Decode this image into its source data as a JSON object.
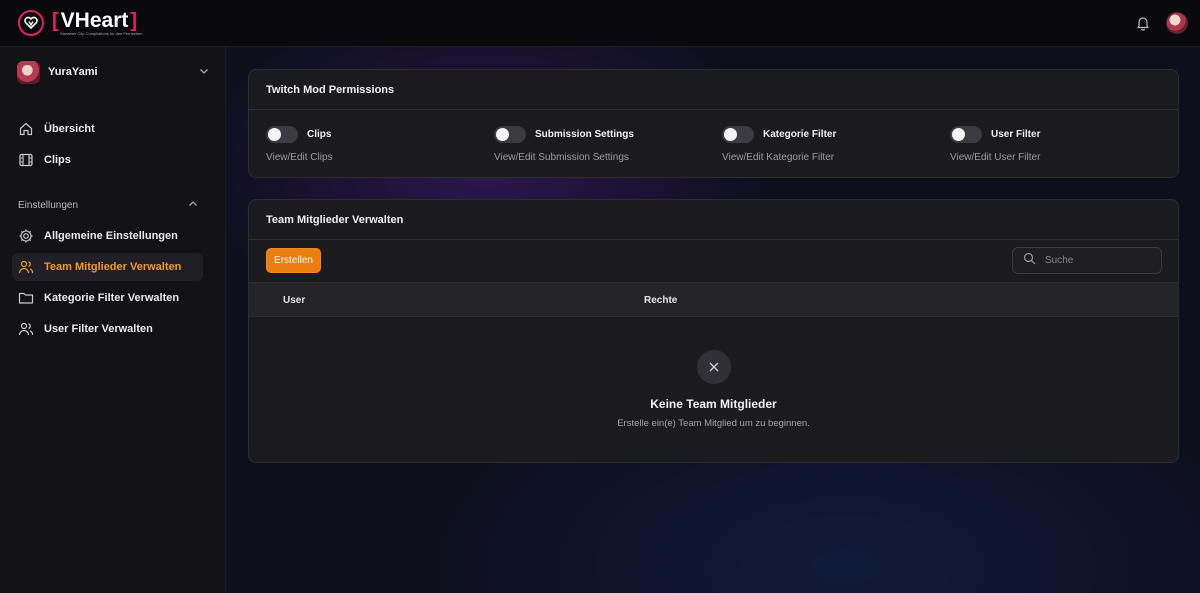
{
  "app": {
    "brand": "VHeart",
    "tagline": "Streamer Clip Compilations for den Fernsehen",
    "brand_color": "#e0206a",
    "accent_color": "#ee7d0f"
  },
  "topbar": {
    "icons": [
      "bell-icon",
      "user-avatar"
    ]
  },
  "sidebar": {
    "user": {
      "name": "YuraYami"
    },
    "nav": [
      {
        "label": "Übersicht",
        "icon": "home-icon"
      },
      {
        "label": "Clips",
        "icon": "film-icon"
      }
    ],
    "section_label": "Einstellungen",
    "settings": [
      {
        "label": "Allgemeine Einstellungen",
        "icon": "gear-icon",
        "active": false
      },
      {
        "label": "Team Mitglieder Verwalten",
        "icon": "users-icon",
        "active": true
      },
      {
        "label": "Kategorie Filter Verwalten",
        "icon": "folder-icon",
        "active": false
      },
      {
        "label": "User Filter Verwalten",
        "icon": "users-icon",
        "active": false
      }
    ]
  },
  "permissions": {
    "title": "Twitch Mod Permissions",
    "items": [
      {
        "title": "Clips",
        "desc": "View/Edit Clips",
        "enabled": false
      },
      {
        "title": "Submission Settings",
        "desc": "View/Edit Submission Settings",
        "enabled": false
      },
      {
        "title": "Kategorie Filter",
        "desc": "View/Edit Kategorie Filter",
        "enabled": false
      },
      {
        "title": "User Filter",
        "desc": "View/Edit User Filter",
        "enabled": false
      }
    ]
  },
  "team": {
    "title": "Team Mitglieder Verwalten",
    "create_label": "Erstellen",
    "search_placeholder": "Suche",
    "columns": [
      "User",
      "Rechte"
    ],
    "empty_title": "Keine Team Mitglieder",
    "empty_subtitle": "Erstelle ein(e) Team Mitglied um zu beginnen."
  }
}
